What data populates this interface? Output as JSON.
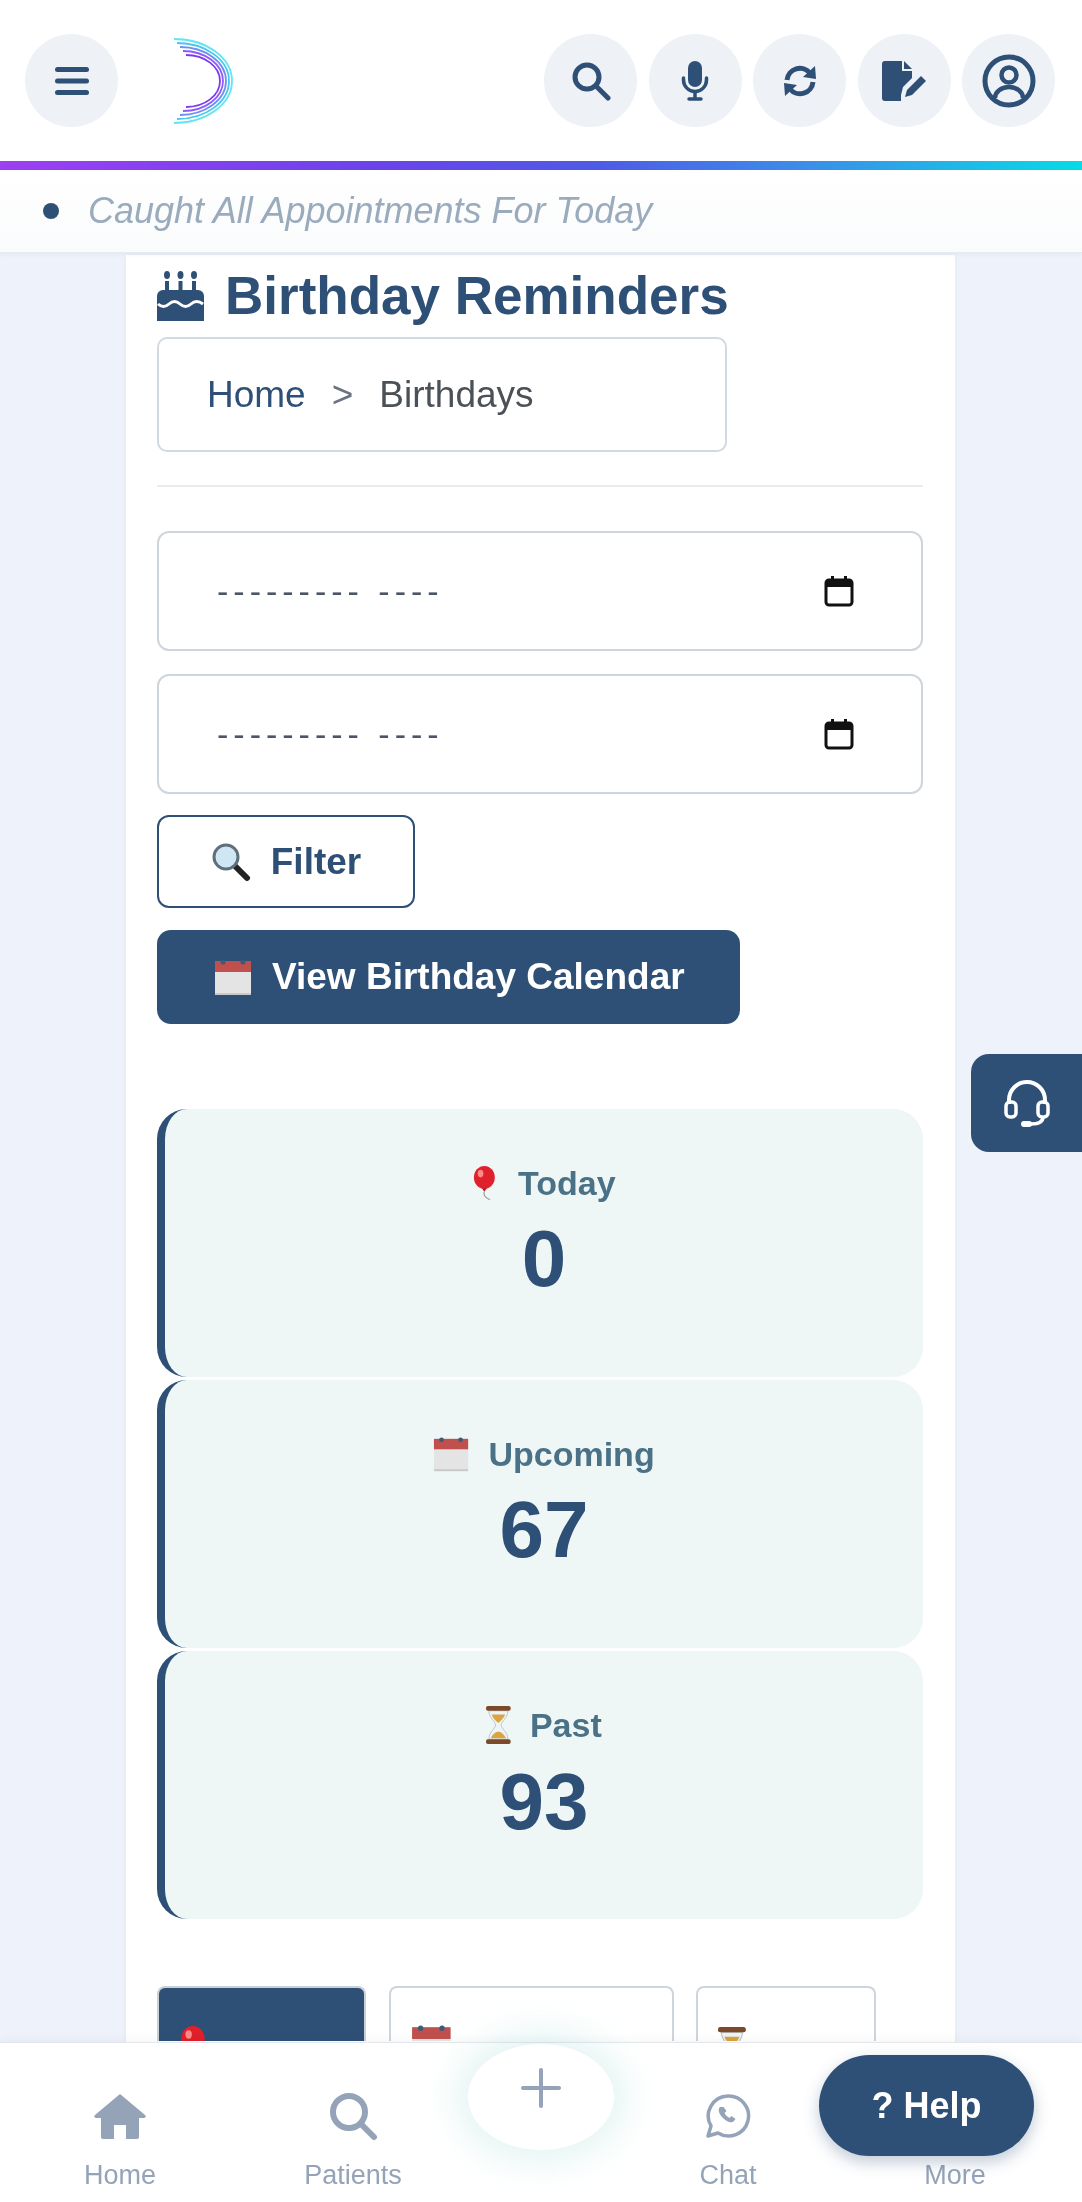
{
  "ticker": {
    "text": "Caught All Appointments For Today"
  },
  "page": {
    "title": "Birthday Reminders",
    "breadcrumb": [
      {
        "label": "Home",
        "kind": "link"
      },
      {
        "label": ">",
        "kind": "separator"
      },
      {
        "label": "Birthdays",
        "kind": "current"
      }
    ]
  },
  "filters": {
    "date_fields": [
      {
        "placeholder": "--------- ----"
      },
      {
        "placeholder": "--------- ----"
      }
    ],
    "filter_button": {
      "label": "Filter"
    },
    "calendar_button": {
      "label": "View Birthday Calendar"
    }
  },
  "stats": [
    {
      "kind": "balloon",
      "label": "Today",
      "value": "0"
    },
    {
      "kind": "calendar",
      "label": "Upcoming",
      "value": "67"
    },
    {
      "kind": "hourglass",
      "label": "Past",
      "value": "93"
    }
  ],
  "tabs": [
    {
      "kind": "balloon",
      "selected": true
    },
    {
      "kind": "calendar",
      "selected": false
    },
    {
      "kind": "hourglass",
      "selected": false
    }
  ],
  "bottom_nav": [
    {
      "kind": "home",
      "label": "Home"
    },
    {
      "kind": "search",
      "label": "Patients"
    },
    {
      "kind": "add"
    },
    {
      "kind": "chat",
      "label": "Chat"
    },
    {
      "kind": "more",
      "label": "More"
    }
  ],
  "help_button": {
    "label": "? Help"
  }
}
